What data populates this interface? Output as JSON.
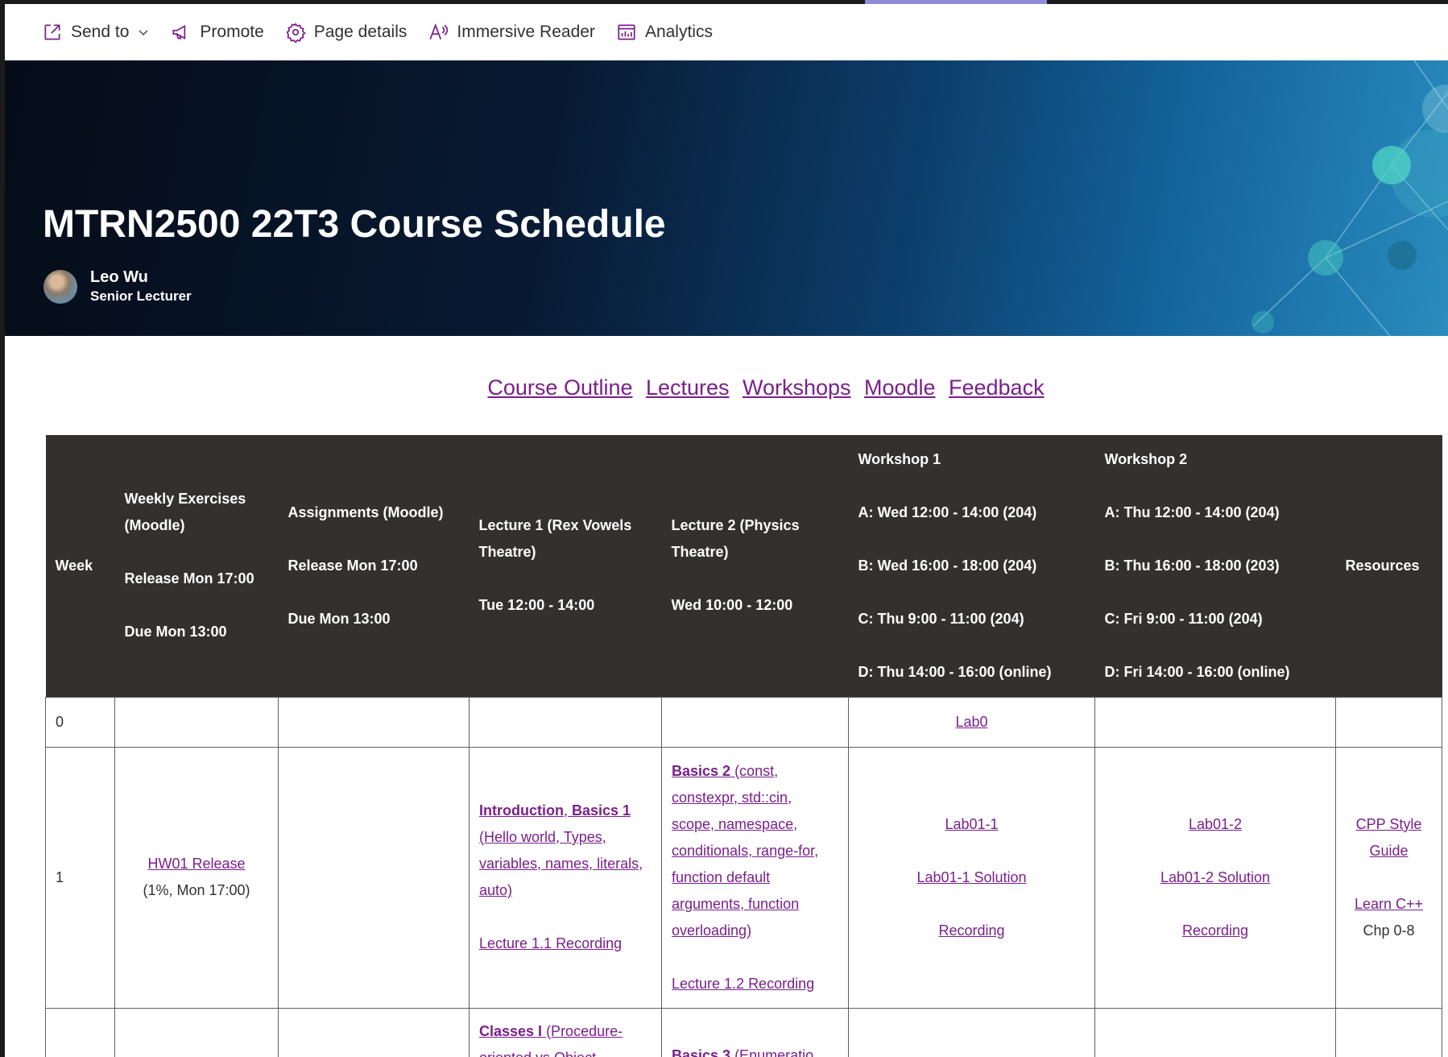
{
  "toolbar": {
    "send_to": "Send to",
    "promote": "Promote",
    "page_details": "Page details",
    "immersive_reader": "Immersive Reader",
    "analytics": "Analytics"
  },
  "banner": {
    "title": "MTRN2500 22T3 Course Schedule",
    "author_name": "Leo Wu",
    "author_role": "Senior Lecturer"
  },
  "quick_links": [
    "Course Outline",
    "Lectures",
    "Workshops",
    "Moodle",
    "Feedback"
  ],
  "table": {
    "headers": {
      "week": "Week",
      "weekly": [
        "Weekly Exercises (Moodle)",
        "Release Mon 17:00",
        "Due Mon 13:00"
      ],
      "assign": [
        "Assignments (Moodle)",
        "Release Mon 17:00",
        "Due Mon 13:00"
      ],
      "lec1": [
        "Lecture 1 (Rex Vowels Theatre)",
        "Tue 12:00 - 14:00"
      ],
      "lec2": [
        "Lecture 2 (Physics Theatre)",
        "Wed 10:00 - 12:00"
      ],
      "ws1": [
        "Workshop 1",
        "A: Wed 12:00 - 14:00 (204)",
        "B: Wed 16:00 - 18:00 (204)",
        "C: Thu 9:00 - 11:00 (204)",
        "D: Thu 14:00 - 16:00 (online)"
      ],
      "ws2": [
        "Workshop 2",
        "A: Thu 12:00 - 14:00 (204)",
        "B: Thu 16:00 - 18:00 (203)",
        "C: Fri 9:00 - 11:00 (204)",
        "D: Fri 14:00 - 16:00 (online)"
      ],
      "resources": "Resources"
    },
    "row0": {
      "week": "0",
      "ws1": "Lab0"
    },
    "row1": {
      "week": "1",
      "hw_link": "HW01 Release",
      "hw_note": "(1%, Mon 17:00)",
      "lec1_title1": "Introduction",
      "lec1_sep": ", ",
      "lec1_title2": "Basics 1",
      "lec1_desc": "(Hello world, Types, variables, names, literals, auto)",
      "lec1_rec": "Lecture 1.1 Recording",
      "lec2_title": "Basics 2",
      "lec2_desc": " (const, constexpr, std::cin, scope, namespace, conditionals, range-for, function default arguments, function overloading)",
      "lec2_rec": "Lecture 1.2 Recording",
      "ws1_lab": "Lab01-1",
      "ws1_sol": "Lab01-1 Solution",
      "ws1_rec": "Recording",
      "ws2_lab": "Lab01-2",
      "ws2_sol": "Lab01-2 Solution",
      "ws2_rec": "Recording",
      "res_style": "CPP Style Guide",
      "res_learn": "Learn C++",
      "res_chp": " Chp 0-8"
    },
    "row2": {
      "lec1_title": "Classes I",
      "lec1_desc": " (Procedure-oriented vs Object",
      "lec2_title": "Basics 3",
      "lec2_desc": " (Enumeratio"
    }
  }
}
